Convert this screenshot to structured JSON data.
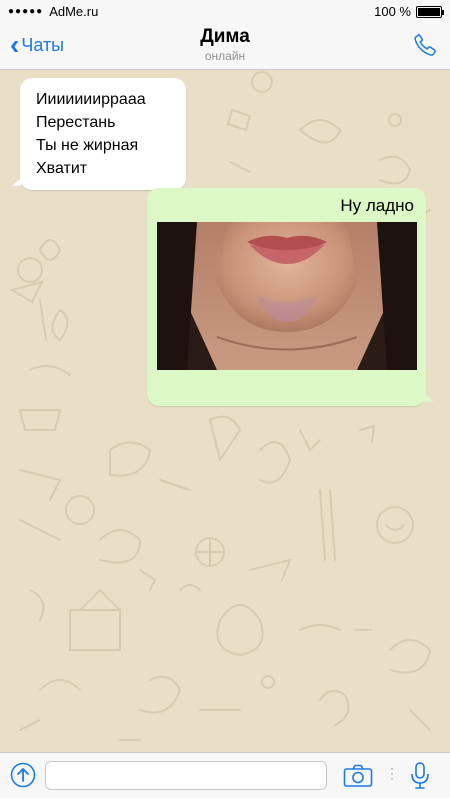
{
  "status_bar": {
    "signal_dots": "●●●●●",
    "carrier": "AdMe.ru",
    "battery_text": "100 %",
    "battery_level": 1.0
  },
  "nav": {
    "back_label": "Чаты",
    "back_icon": "chevron-left-icon",
    "title": "Дима",
    "subtitle": "онлайн",
    "call_icon": "phone-icon"
  },
  "messages": [
    {
      "direction": "incoming",
      "lines": [
        "Иииииииррааа",
        "Перестань",
        "Ты не жирная",
        "Хватит"
      ]
    },
    {
      "direction": "outgoing",
      "caption": "Ну ладно",
      "has_photo": true
    }
  ],
  "input_bar": {
    "share_icon": "arrow-up-circle-icon",
    "placeholder": "",
    "camera_icon": "camera-icon",
    "mic_icon": "microphone-icon"
  },
  "colors": {
    "accent": "#1a7ae6",
    "chat_background": "#e9dfc7",
    "outgoing_bubble": "#dcf8c6",
    "incoming_bubble": "#ffffff"
  }
}
